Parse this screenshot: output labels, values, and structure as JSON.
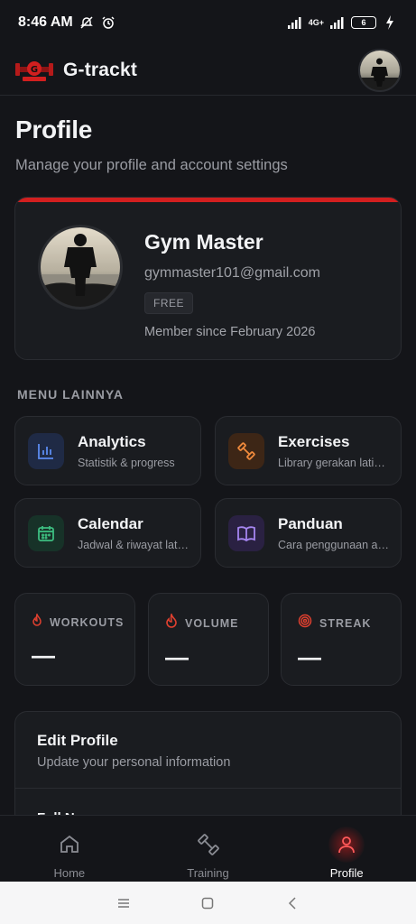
{
  "status_bar": {
    "time": "8:46 AM",
    "network": "4G+",
    "battery": "6"
  },
  "app": {
    "name": "G-trackt",
    "logo_icon": "gym-logo-icon"
  },
  "page": {
    "title": "Profile",
    "subtitle": "Manage your profile and account settings"
  },
  "profile": {
    "name": "Gym Master",
    "email": "gymmaster101@gmail.com",
    "plan": "FREE",
    "member_since": "Member since February 2026"
  },
  "menu": {
    "section_label": "MENU LAINNYA",
    "items": [
      {
        "title": "Analytics",
        "desc": "Statistik & progress",
        "icon": "bar-chart-icon",
        "color": "#3b6fd8"
      },
      {
        "title": "Exercises",
        "desc": "Library gerakan latihan",
        "icon": "dumbbell-icon",
        "color": "#e0792f"
      },
      {
        "title": "Calendar",
        "desc": "Jadwal & riwayat latihan",
        "icon": "calendar-icon",
        "color": "#2fa36b"
      },
      {
        "title": "Panduan",
        "desc": "Cara penggunaan aplikasi",
        "icon": "book-icon",
        "color": "#8f6cd8"
      }
    ]
  },
  "stats": [
    {
      "label": "WORKOUTS",
      "value": "—",
      "icon": "flame-small-icon"
    },
    {
      "label": "VOLUME",
      "value": "—",
      "icon": "flame-icon"
    },
    {
      "label": "STREAK",
      "value": "—",
      "icon": "target-icon"
    }
  ],
  "edit_profile": {
    "title": "Edit Profile",
    "desc": "Update your personal information",
    "field_label": "Full N"
  },
  "bottom_nav": {
    "items": [
      {
        "label": "Home",
        "icon": "home-icon"
      },
      {
        "label": "Training",
        "icon": "dumbbell-icon"
      },
      {
        "label": "Profile",
        "icon": "person-icon"
      }
    ],
    "active_index": 2
  },
  "colors": {
    "accent": "#d21f1f",
    "background": "#141519",
    "card": "#1a1c20"
  }
}
